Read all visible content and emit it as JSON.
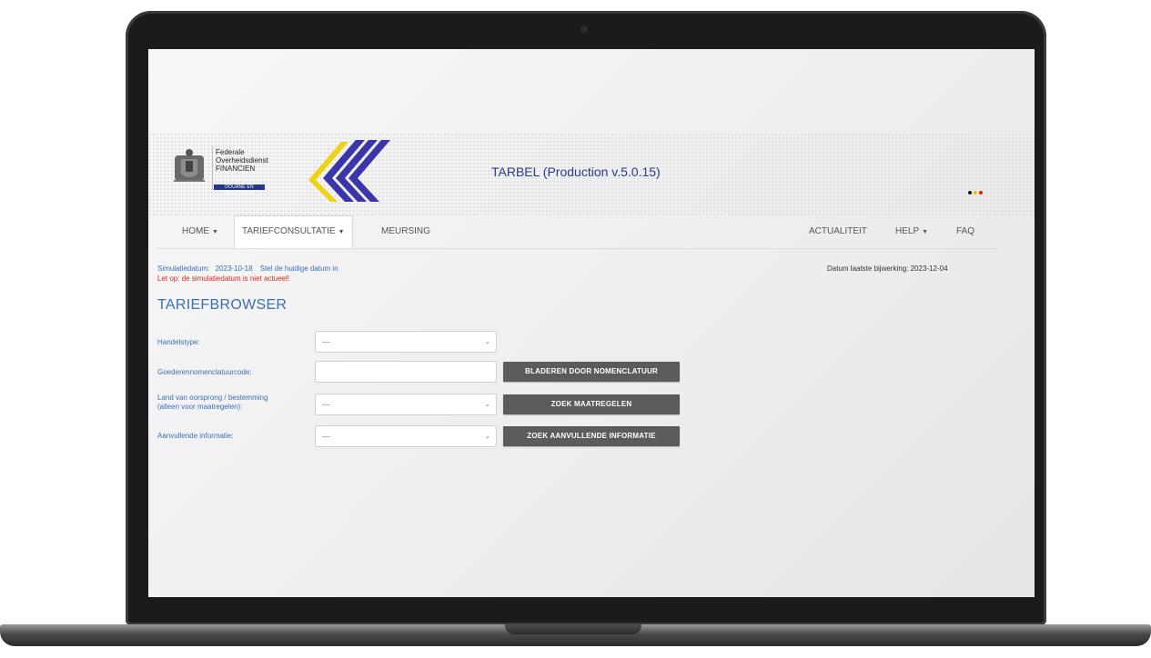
{
  "app": {
    "title": "TARBEL (Production v.5.0.15)",
    "org_lines": [
      "Federale",
      "Overheidsdienst",
      "FINANCIEN"
    ],
    "org_tag": "DOUANE EN ACCIJNZEN",
    "brand_colors": {
      "chevron_yellow": "#f0d214",
      "chevron_blue": "#3a35a8",
      "tag_blue": "#25358b"
    },
    "lang_dots": [
      "#1a1a1a",
      "#f3c200",
      "#d81f26"
    ]
  },
  "nav": {
    "home": "HOME",
    "tariff": "TARIEFCONSULTATIE",
    "meursing": "MEURSING",
    "news": "ACTUALITEIT",
    "help": "HELP",
    "faq": "FAQ"
  },
  "status": {
    "sim_label": "Simulatiedatum:",
    "sim_date": "2023-10-18",
    "set_today_link": "Stel de huidige datum in",
    "warning": "Let op: de simulatiedatum is niet actueel!",
    "last_update": "Datum laatste bijwerking: 2023-12-04"
  },
  "page": {
    "title": "TARIEFBROWSER"
  },
  "form": {
    "trade_type_label": "Handelstype:",
    "trade_type_value": "---",
    "code_label": "Goederennomenclatuurcode:",
    "code_value": "",
    "browse_button": "BLADEREN DOOR NOMENCLATUUR",
    "country_label_1": "Land van oorsprong / bestemming",
    "country_label_2": "(alleen voor maatregelen):",
    "country_value": "---",
    "measures_button": "ZOEK MAATREGELEN",
    "extra_label": "Aanvullende informatie:",
    "extra_value": "---",
    "extra_button": "ZOEK AANVULLENDE INFORMATIE"
  }
}
